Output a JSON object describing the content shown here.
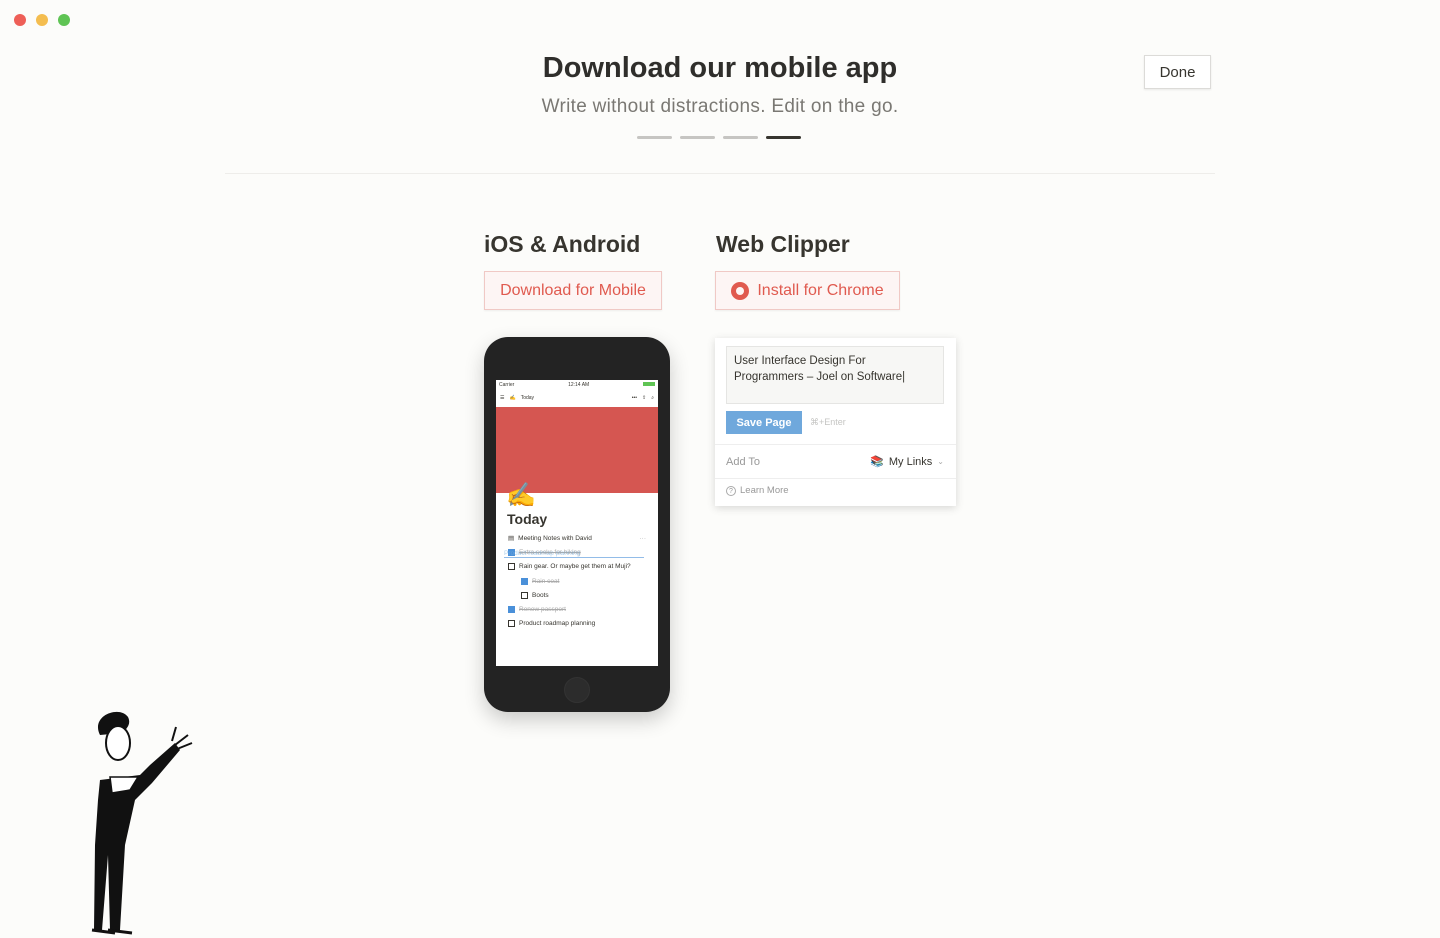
{
  "window": {
    "traffic_lights": [
      "#ee5f57",
      "#f4bd4f",
      "#5fc454"
    ]
  },
  "header": {
    "title": "Download our mobile app",
    "subtitle": "Write without distractions. Edit on the go.",
    "done_label": "Done",
    "steps_total": 4,
    "current_step": 4
  },
  "mobile": {
    "heading": "iOS & Android",
    "button_label": "Download for Mobile",
    "phone": {
      "carrier": "Carrier",
      "time": "12:14 AM",
      "nav_title": "Today",
      "more": "•••",
      "page_title": "Today",
      "items": [
        {
          "text": "Meeting Notes with David",
          "type": "page"
        },
        {
          "text": "Extra socks for hiking",
          "checked": true
        },
        {
          "text": "Rain gear. Or maybe get them at Muji?",
          "checked": false
        },
        {
          "text": "Rain coat",
          "checked": true,
          "indent": true
        },
        {
          "text": "Boots",
          "checked": false,
          "indent": true
        },
        {
          "text": "Renew passport",
          "checked": true
        },
        {
          "text": "Product roadmap planning",
          "checked": false
        }
      ],
      "drag_ghost": "Product roadmap planning"
    }
  },
  "clipper": {
    "heading": "Web Clipper",
    "button_label": "Install for Chrome",
    "title_value": "User Interface Design For Programmers – Joel on Software",
    "save_label": "Save Page",
    "shortcut": "⌘+Enter",
    "add_to_label": "Add To",
    "destination": "My Links",
    "learn_more": "Learn More"
  },
  "accent": "#e05a4f"
}
